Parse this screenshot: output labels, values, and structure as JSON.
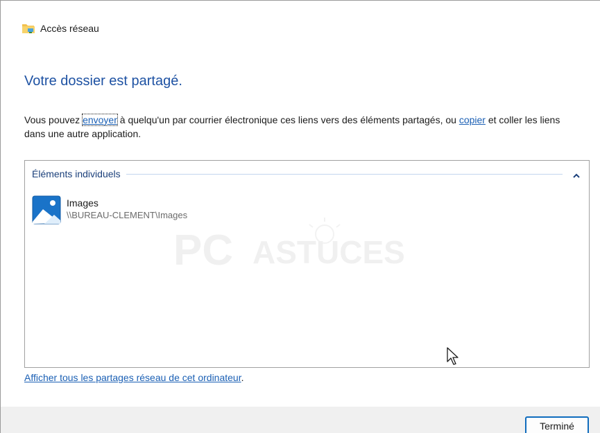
{
  "window": {
    "title": "Accès réseau",
    "icon": "network-folder-icon"
  },
  "heading": "Votre dossier est partagé.",
  "description": {
    "part1": "Vous pouvez ",
    "send_link": "envoyer",
    "part2": " à quelqu'un par courrier électronique ces liens vers des éléments partagés, ou ",
    "copy_link": "copier",
    "part3": " et coller les liens dans une autre application."
  },
  "shared_items": {
    "group_label": "Éléments individuels",
    "collapse_icon": "chevron-up-icon",
    "items": [
      {
        "name": "Images",
        "path": "\\\\BUREAU-CLEMENT\\Images",
        "icon": "pictures-folder-icon"
      }
    ]
  },
  "watermark": {
    "text_pc": "PC",
    "text_astuces": "ASTUCES"
  },
  "bottom_link": {
    "label": "Afficher tous les partages réseau de cet ordinateur",
    "suffix": "."
  },
  "footer": {
    "done_label": "Terminé"
  },
  "colors": {
    "heading": "#1e52a3",
    "link": "#1a5fb4",
    "accent": "#0f6cbd",
    "footer_bg": "#f0f0f0"
  }
}
